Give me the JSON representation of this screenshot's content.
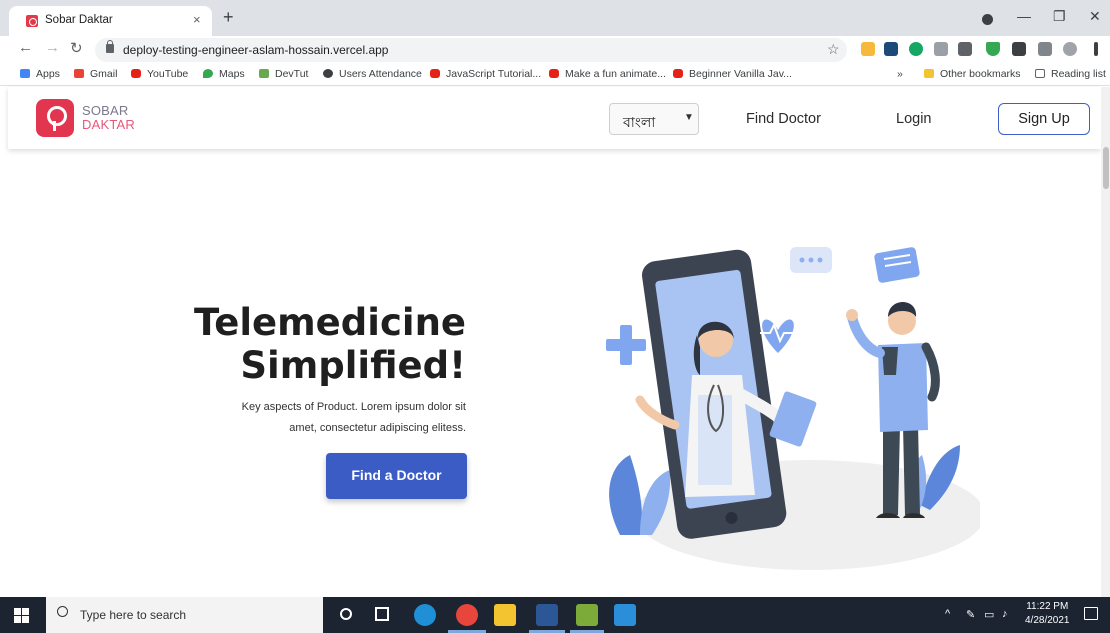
{
  "browser": {
    "tab_title": "Sobar Daktar",
    "tab_close": "×",
    "new_tab": "+",
    "url": "deploy-testing-engineer-aslam-hossain.vercel.app",
    "bookmarks": [
      {
        "label": "Apps"
      },
      {
        "label": "Gmail"
      },
      {
        "label": "YouTube"
      },
      {
        "label": "Maps"
      },
      {
        "label": "DevTut"
      },
      {
        "label": "Users Attendance"
      },
      {
        "label": "JavaScript Tutorial..."
      },
      {
        "label": "Make a fun animate..."
      },
      {
        "label": "Beginner Vanilla Jav..."
      }
    ],
    "overflow": "»",
    "other_bookmarks": "Other bookmarks",
    "reading_list": "Reading list"
  },
  "site": {
    "logo_line1": "SOBAR",
    "logo_line2": "DAKTAR",
    "language_value": "বাংলা",
    "nav_find_doctor": "Find Doctor",
    "nav_login": "Login",
    "nav_signup": "Sign Up",
    "hero_title_line1": "Telemedicine",
    "hero_title_line2": "Simplified!",
    "hero_subtitle_line1": "Key aspects of Product. Lorem ipsum dolor sit",
    "hero_subtitle_line2": "amet, consectetur adipiscing elitess.",
    "hero_button": "Find a Doctor"
  },
  "taskbar": {
    "search_placeholder": "Type here to search",
    "time": "11:22 PM",
    "date": "4/28/2021"
  },
  "colors": {
    "brand_red": "#e23650",
    "brand_pink": "#e8577a",
    "primary_blue": "#3b5cc4"
  }
}
